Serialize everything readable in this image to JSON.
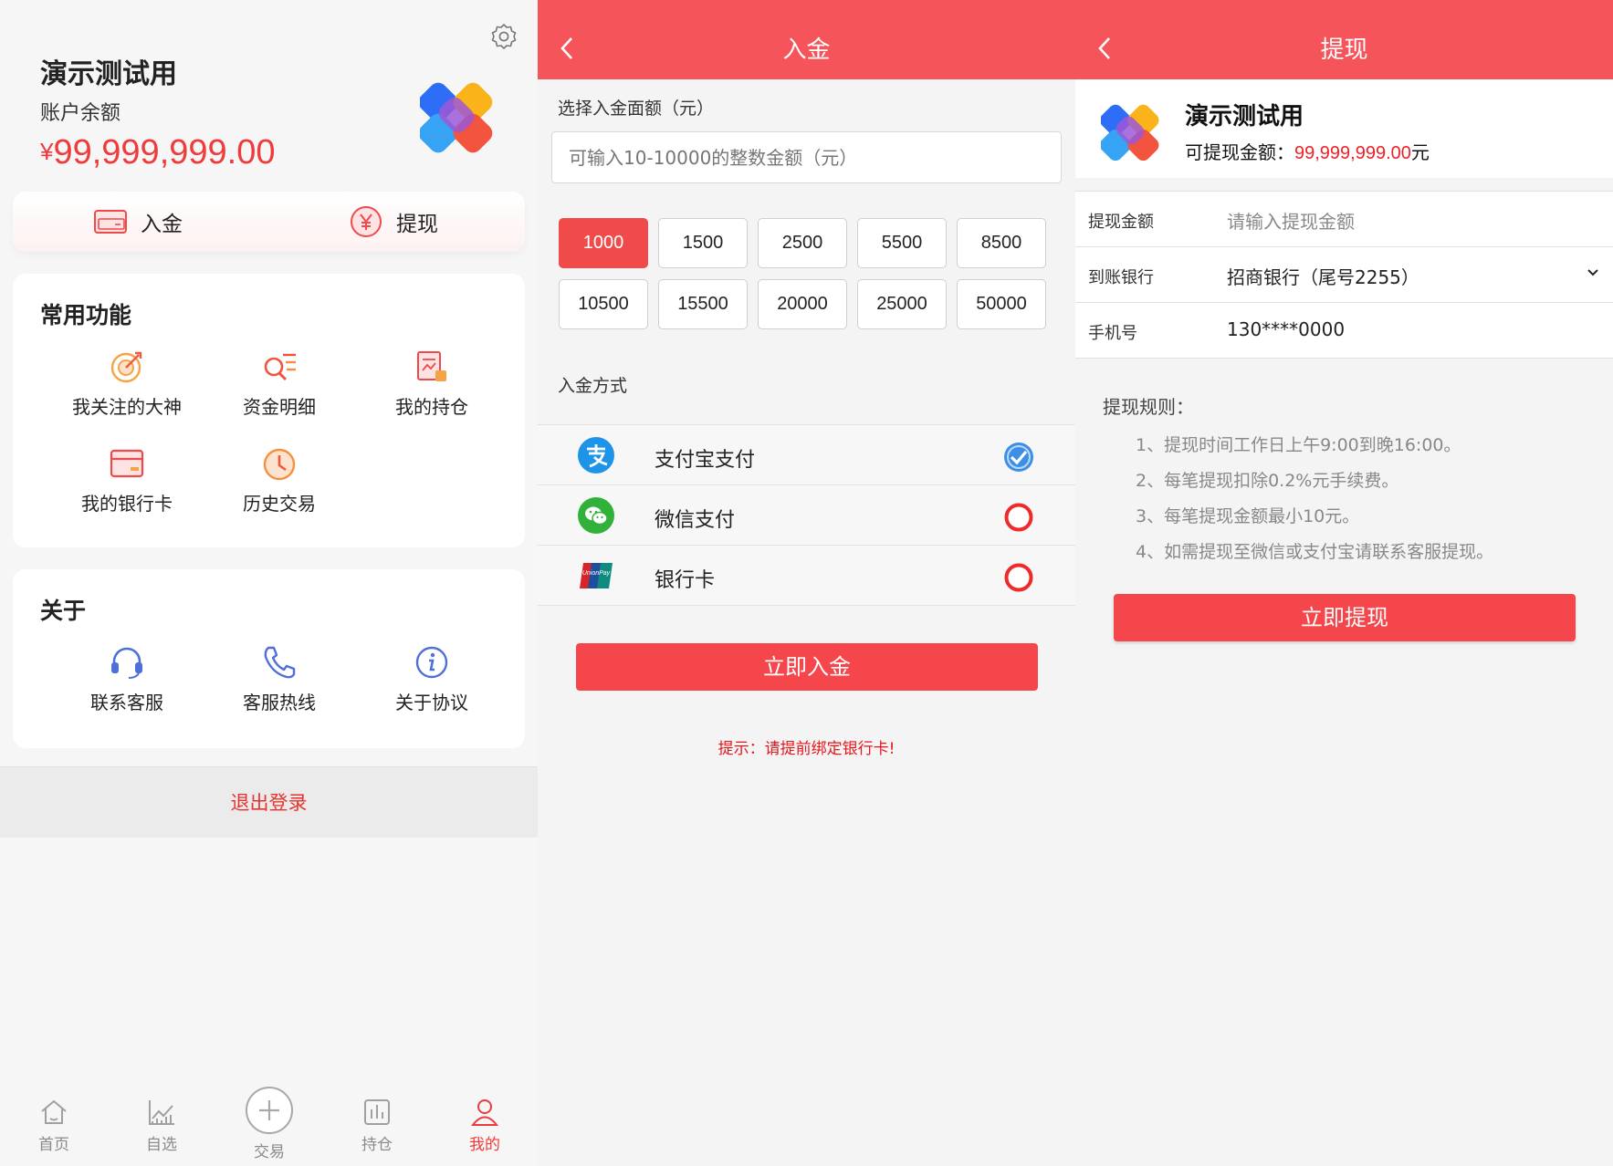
{
  "profile": {
    "name": "演示测试用",
    "balance_label": "账户余额",
    "currency_symbol": "¥",
    "balance": "99,999,999.00",
    "deposit_label": "入金",
    "withdraw_label": "提现",
    "common_title": "常用功能",
    "common_items": [
      {
        "label": "我关注的大神",
        "icon": "target-icon"
      },
      {
        "label": "资金明细",
        "icon": "fund-search-icon"
      },
      {
        "label": "我的持仓",
        "icon": "holdings-icon"
      },
      {
        "label": "我的银行卡",
        "icon": "bank-card-icon"
      },
      {
        "label": "历史交易",
        "icon": "clock-icon"
      }
    ],
    "about_title": "关于",
    "about_items": [
      {
        "label": "联系客服",
        "icon": "headset-icon"
      },
      {
        "label": "客服热线",
        "icon": "phone-icon"
      },
      {
        "label": "关于协议",
        "icon": "info-icon"
      }
    ],
    "logout_label": "退出登录",
    "tabs": [
      {
        "label": "首页",
        "icon": "home-icon"
      },
      {
        "label": "自选",
        "icon": "chart-line-icon"
      },
      {
        "label": "交易",
        "icon": "plus-circle-icon"
      },
      {
        "label": "持仓",
        "icon": "bar-chart-icon"
      },
      {
        "label": "我的",
        "icon": "user-icon",
        "active": true
      }
    ]
  },
  "deposit": {
    "title": "入金",
    "amount_label": "选择入金面额（元）",
    "amount_placeholder": "可输入10-10000的整数金额（元）",
    "amounts": [
      "1000",
      "1500",
      "2500",
      "5500",
      "8500",
      "10500",
      "15500",
      "20000",
      "25000",
      "50000"
    ],
    "selected_amount": "1000",
    "method_label": "入金方式",
    "methods": [
      {
        "label": "支付宝支付",
        "icon": "alipay-icon",
        "selected": true
      },
      {
        "label": "微信支付",
        "icon": "wechat-icon",
        "selected": false
      },
      {
        "label": "银行卡",
        "icon": "unionpay-icon",
        "selected": false
      }
    ],
    "submit_label": "立即入金",
    "tip": "提示：请提前绑定银行卡!"
  },
  "withdraw": {
    "title": "提现",
    "name": "演示测试用",
    "available_label": "可提现金额：",
    "available_amount": "99,999,999.00",
    "available_unit": "元",
    "amount_label": "提现金额",
    "amount_placeholder": "请输入提现金额",
    "bank_label": "到账银行",
    "bank_value": "招商银行（尾号2255）",
    "phone_label": "手机号",
    "phone_value": "130****0000",
    "rules_title": "提现规则：",
    "rules": [
      "1、提现时间工作日上午9:00到晚16:00。",
      "2、每笔提现扣除0.2%元手续费。",
      "3、每笔提现金额最小10元。",
      "4、如需提现至微信或支付宝请联系客服提现。"
    ],
    "submit_label": "立即提现"
  },
  "colors": {
    "accent": "#f5545a",
    "button": "#f5474b",
    "amount_red": "#ef3b3b",
    "tip_red": "#e5171c"
  }
}
